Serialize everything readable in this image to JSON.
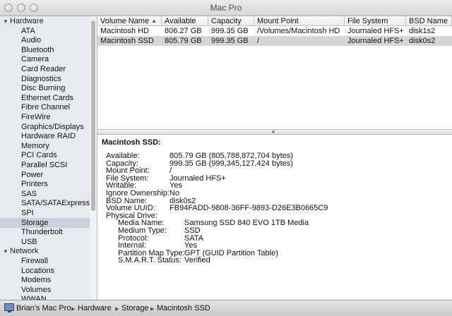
{
  "window": {
    "title": "Mac Pro"
  },
  "sidebar": {
    "sections": [
      {
        "label": "Hardware",
        "items": [
          "ATA",
          "Audio",
          "Bluetooth",
          "Camera",
          "Card Reader",
          "Diagnostics",
          "Disc Burning",
          "Ethernet Cards",
          "Fibre Channel",
          "FireWire",
          "Graphics/Displays",
          "Hardware RAID",
          "Memory",
          "PCI Cards",
          "Parallel SCSI",
          "Power",
          "Printers",
          "SAS",
          "SATA/SATAExpress",
          "SPI",
          "Storage",
          "Thunderbolt",
          "USB"
        ]
      },
      {
        "label": "Network",
        "items": [
          "Firewall",
          "Locations",
          "Modems",
          "Volumes",
          "WWAN"
        ]
      }
    ],
    "selected": "Storage"
  },
  "table": {
    "columns": [
      "Volume Name",
      "Available",
      "Capacity",
      "Mount Point",
      "File System",
      "BSD Name"
    ],
    "rows": [
      [
        "Macintosh HD",
        "806.27 GB",
        "999.35 GB",
        "/Volumes/Macintosh HD",
        "Journaled HFS+",
        "disk1s2"
      ],
      [
        "Macintosh SSD",
        "805.79 GB",
        "999.35 GB",
        "/",
        "Journaled HFS+",
        "disk0s2"
      ]
    ],
    "selected_row": 1
  },
  "detail": {
    "title": "Macintosh SSD:",
    "fields": [
      {
        "label": "Available:",
        "value": "805.79 GB (805,788,872,704 bytes)"
      },
      {
        "label": "Capacity:",
        "value": "999.35 GB (999,345,127,424 bytes)"
      },
      {
        "label": "Mount Point:",
        "value": "/"
      },
      {
        "label": "File System:",
        "value": "Journaled HFS+"
      },
      {
        "label": "Writable:",
        "value": "Yes"
      },
      {
        "label": "Ignore Ownership:",
        "value": "No"
      },
      {
        "label": "BSD Name:",
        "value": "disk0s2"
      },
      {
        "label": "Volume UUID:",
        "value": "FB94FADD-9808-36FF-9893-D26E3B0665C9"
      },
      {
        "label": "Physical Drive:",
        "value": ""
      }
    ],
    "physical_drive": [
      {
        "label": "Media Name:",
        "value": "Samsung SSD 840 EVO 1TB Media"
      },
      {
        "label": "Medium Type:",
        "value": "SSD"
      },
      {
        "label": "Protocol:",
        "value": "SATA"
      },
      {
        "label": "Internal:",
        "value": "Yes"
      },
      {
        "label": "Partition Map Type:",
        "value": "GPT (GUID Partition Table)"
      },
      {
        "label": "S.M.A.R.T. Status:",
        "value": "Verified"
      }
    ]
  },
  "pathbar": {
    "items": [
      "Brian’s Mac Pro",
      "Hardware",
      "Storage",
      "Macintosh SSD"
    ],
    "separator": "▸"
  },
  "icons": {
    "computer": "computer-icon",
    "sort": "sort-ascending-icon",
    "disclosure": "disclosure-triangle-icon"
  }
}
